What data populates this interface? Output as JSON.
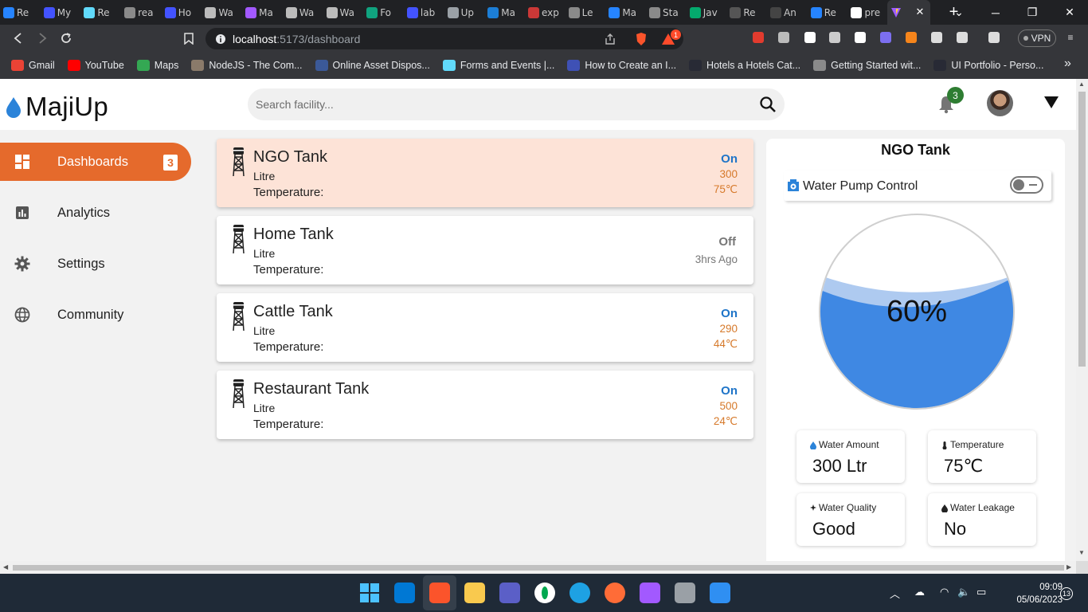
{
  "browser": {
    "tabs": [
      {
        "label": "Re",
        "icon": "jira-icon",
        "color": "#2684ff"
      },
      {
        "label": "My",
        "icon": "webflow-icon",
        "color": "#4353ff"
      },
      {
        "label": "Re",
        "icon": "react-icon",
        "color": "#61dafb"
      },
      {
        "label": "rea",
        "icon": "globe-icon",
        "color": "#8a8a8a"
      },
      {
        "label": "Ho",
        "icon": "webflow-icon",
        "color": "#4353ff"
      },
      {
        "label": "Wa",
        "icon": "bank-icon",
        "color": "#bbbbbb"
      },
      {
        "label": "Ma",
        "icon": "figma-icon",
        "color": "#a259ff"
      },
      {
        "label": "Wa",
        "icon": "bank-icon",
        "color": "#bbbbbb"
      },
      {
        "label": "Wa",
        "icon": "bank-icon",
        "color": "#bbbbbb"
      },
      {
        "label": "Fo",
        "icon": "chatgpt-icon",
        "color": "#10a37f"
      },
      {
        "label": "lab",
        "icon": "webflow-icon",
        "color": "#4353ff"
      },
      {
        "label": "Up",
        "icon": "layers-icon",
        "color": "#9aa0a6"
      },
      {
        "label": "Ma",
        "icon": "mantine-icon",
        "color": "#1c7ed6"
      },
      {
        "label": "exp",
        "icon": "npm-icon",
        "color": "#cb3837"
      },
      {
        "label": "Le",
        "icon": "globe-icon",
        "color": "#8a8a8a"
      },
      {
        "label": "Ma",
        "icon": "jira-icon",
        "color": "#2684ff"
      },
      {
        "label": "Sta",
        "icon": "globe-icon",
        "color": "#8a8a8a"
      },
      {
        "label": "Jav",
        "icon": "w3-icon",
        "color": "#04aa6d"
      },
      {
        "label": "Re",
        "icon": "css-icon",
        "color": "#555555"
      },
      {
        "label": "An",
        "icon": "medium-icon",
        "color": "#444444"
      },
      {
        "label": "Re",
        "icon": "jira-icon",
        "color": "#2684ff"
      },
      {
        "label": "pre",
        "icon": "google-icon",
        "color": "#ffffff"
      }
    ],
    "active_tab": {
      "icon": "vite-icon",
      "close": "✕"
    },
    "new_tab": "+",
    "url_host": "localhost",
    "url_path": ":5173/dashboard",
    "vpn_label": "VPN",
    "brave_badge": "1",
    "bookmarks": [
      {
        "label": "Gmail",
        "icon": "gmail-icon",
        "color": "#ea4335"
      },
      {
        "label": "YouTube",
        "icon": "youtube-icon",
        "color": "#ff0000"
      },
      {
        "label": "Maps",
        "icon": "maps-icon",
        "color": "#34a853"
      },
      {
        "label": "NodeJS - The Com...",
        "icon": "nodejs-icon",
        "color": "#8a7a6a"
      },
      {
        "label": "Online Asset Dispos...",
        "icon": "asset-icon",
        "color": "#3b5998"
      },
      {
        "label": "Forms and Events |...",
        "icon": "react-icon",
        "color": "#61dafb"
      },
      {
        "label": "How to Create an I...",
        "icon": "ua-icon",
        "color": "#3f51b5"
      },
      {
        "label": "Hotels a Hotels Cat...",
        "icon": "w3-icon",
        "color": "#282a35"
      },
      {
        "label": "Getting Started wit...",
        "icon": "globe-icon",
        "color": "#8a8a8a"
      },
      {
        "label": "UI Portfolio - Perso...",
        "icon": "w3-icon",
        "color": "#282a35"
      }
    ],
    "bookmarks_more": "»"
  },
  "app": {
    "name": "MajiUp",
    "search_placeholder": "Search facility...",
    "notification_count": "3",
    "sidebar": [
      {
        "label": "Dashboards",
        "icon": "dashboard-icon",
        "count": "3",
        "active": true
      },
      {
        "label": "Analytics",
        "icon": "analytics-icon"
      },
      {
        "label": "Settings",
        "icon": "gear-icon"
      },
      {
        "label": "Community",
        "icon": "globe-icon"
      }
    ],
    "tanks": [
      {
        "name": "NGO Tank",
        "unit": "Litre",
        "temp_label": "Temperature:",
        "status": "On",
        "amount": "300",
        "temperature": "75℃",
        "selected": true
      },
      {
        "name": "Home Tank",
        "unit": "Litre",
        "temp_label": "Temperature:",
        "status": "Off",
        "ago": "3hrs Ago"
      },
      {
        "name": "Cattle Tank",
        "unit": "Litre",
        "temp_label": "Temperature:",
        "status": "On",
        "amount": "290",
        "temperature": "44℃"
      },
      {
        "name": "Restaurant Tank",
        "unit": "Litre",
        "temp_label": "Temperature:",
        "status": "On",
        "amount": "500",
        "temperature": "24℃"
      }
    ],
    "detail": {
      "title": "NGO Tank",
      "pump_label": "Water Pump Control",
      "pump_on": false,
      "level_percent_text": "60%",
      "level_fraction": 0.6,
      "stats": [
        {
          "label": "Water Amount",
          "icon": "droplet-icon",
          "value": "300 Ltr"
        },
        {
          "label": "Temperature",
          "icon": "thermometer-icon",
          "value": "75℃"
        },
        {
          "label": "Water Quality",
          "icon": "sparkle-icon",
          "value": "Good"
        },
        {
          "label": "Water Leakage",
          "icon": "leak-icon",
          "value": "No"
        }
      ]
    },
    "colors": {
      "accent": "#e56a2c",
      "on_status": "#1e74c8",
      "amount": "#d6792a",
      "water": "#3f88e3",
      "selected_card": "#fde3d7"
    }
  },
  "taskbar": {
    "time": "09:09",
    "date": "05/06/2023",
    "notifications": "13",
    "apps": [
      {
        "icon": "windows-start-icon",
        "color": "#4cc2ff"
      },
      {
        "icon": "vscode-icon",
        "color": "#0078d4"
      },
      {
        "icon": "brave-icon",
        "color": "#fb542b"
      },
      {
        "icon": "file-explorer-icon",
        "color": "#f9c94e"
      },
      {
        "icon": "teams-icon",
        "color": "#5b5fc7"
      },
      {
        "icon": "mongodb-icon",
        "color": "#00ed64"
      },
      {
        "icon": "edge-icon",
        "color": "#1ea1e3"
      },
      {
        "icon": "postman-icon",
        "color": "#ff6c37"
      },
      {
        "icon": "figma-icon",
        "color": "#a259ff"
      },
      {
        "icon": "virtualbox-icon",
        "color": "#9aa0a6"
      },
      {
        "icon": "media-player-icon",
        "color": "#2f8ff2"
      }
    ]
  }
}
